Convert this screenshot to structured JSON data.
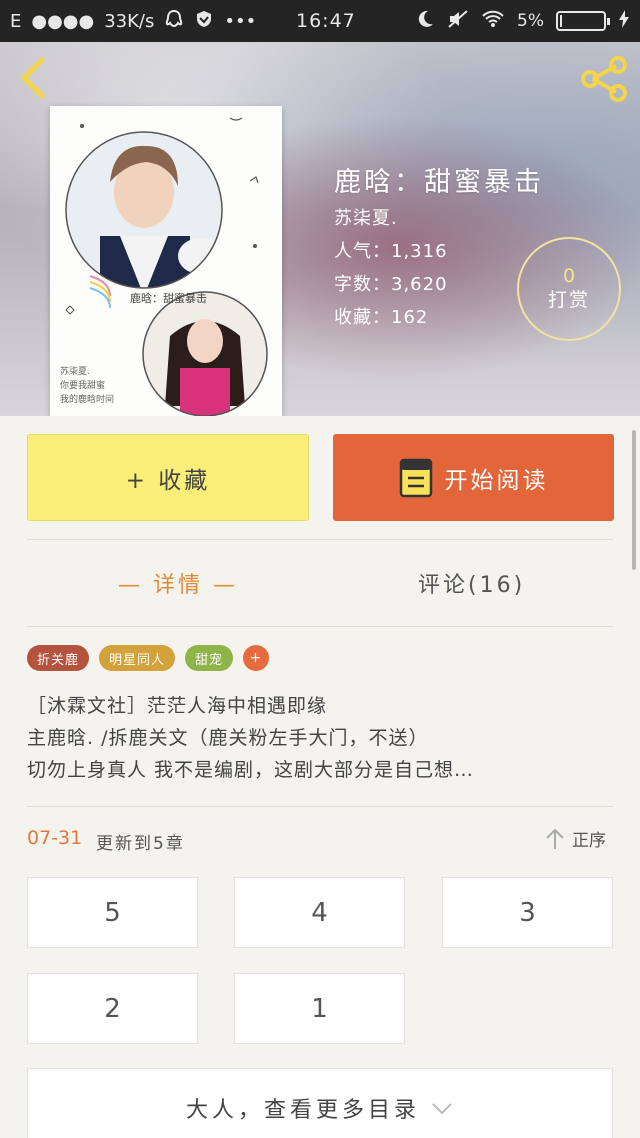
{
  "status_bar": {
    "network": "E",
    "speed": "33K/s",
    "time": "16:47",
    "battery": "5%",
    "battery_level": 0.05
  },
  "book": {
    "title": "鹿晗：甜蜜暴击",
    "author": "苏柒夏.",
    "popularity": "人气：1,316",
    "words": "字数：3,620",
    "favorites": "收藏：162",
    "tip_count": "0",
    "tip_label": "打赏",
    "cover_caption": "鹿晗：甜蜜暴击",
    "cover_note_1": "苏柒夏.",
    "cover_note_2": "你要我甜蜜",
    "cover_note_3": "我的鹿晗时间"
  },
  "actions": {
    "favorite_label": "+ 收藏",
    "read_label": "开始阅读"
  },
  "tabs": {
    "detail": "— 详情 —",
    "comments": "评论(16)"
  },
  "tags": [
    {
      "label": "折关鹿",
      "color": "#b5533f"
    },
    {
      "label": "明星同人",
      "color": "#d4a23a"
    },
    {
      "label": "甜宠",
      "color": "#8fb548"
    },
    {
      "label": "+",
      "color": "#e66b3d"
    }
  ],
  "description": [
    "［沐霖文社］茫茫人海中相遇即缘",
    "主鹿晗. /拆鹿关文（鹿关粉左手大门，不送）",
    "切勿上身真人  我不是编剧，这剧大部分是自己想…"
  ],
  "update": {
    "date": "07-31",
    "text": "更新到5章",
    "sort_label": "正序"
  },
  "chapters": [
    "5",
    "4",
    "3",
    "2",
    "1"
  ],
  "more_label": "大人，查看更多目录",
  "colors": {
    "accent_orange": "#e2663a",
    "accent_yellow": "#f9ee78",
    "tab_active": "#e38a3a"
  },
  "icons": {
    "back": "chevron-left-icon",
    "share": "share-icon",
    "read": "book-icon",
    "sort": "arrow-up-icon",
    "more": "chevron-down-icon"
  }
}
